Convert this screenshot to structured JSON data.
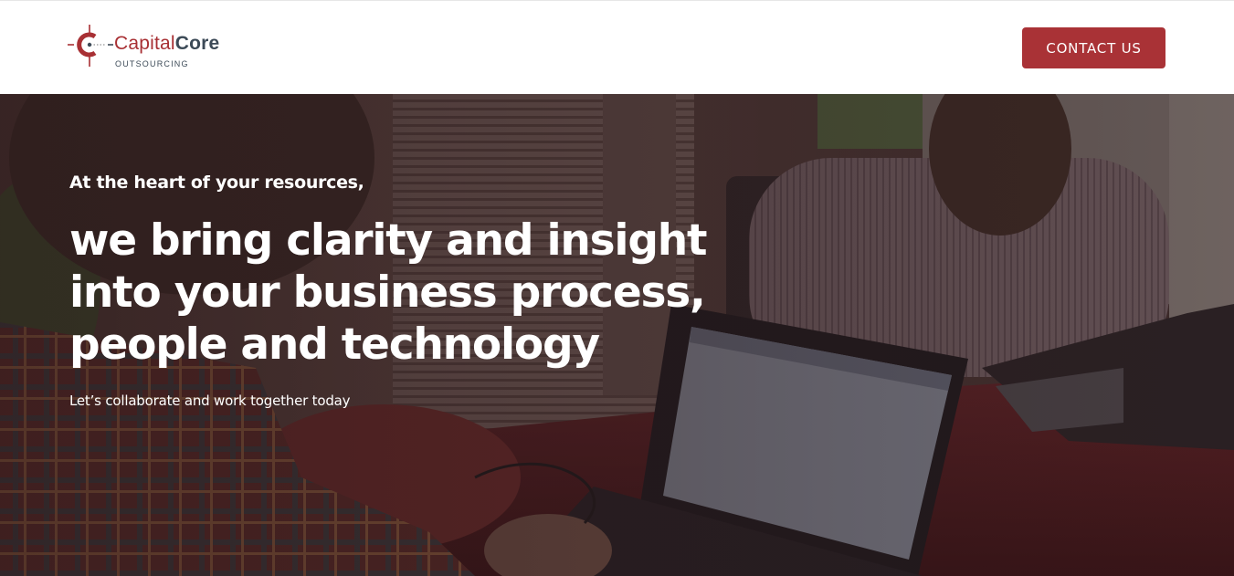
{
  "header": {
    "logo": {
      "word_primary": "Capital",
      "word_secondary": "Core",
      "subtitle": "OUTSOURCING",
      "brand_red": "#a83034",
      "brand_slate": "#3c4a57"
    },
    "contact_label": "CONTACT US",
    "contact_color": "#a93236"
  },
  "hero": {
    "eyebrow": "At the heart of your resources,",
    "headline_lines": [
      "we bring clarity and insight",
      "into your business process,",
      "people and technology"
    ],
    "tagline": "Let’s collaborate and work together today",
    "photo_icon": "office-team-photo"
  }
}
